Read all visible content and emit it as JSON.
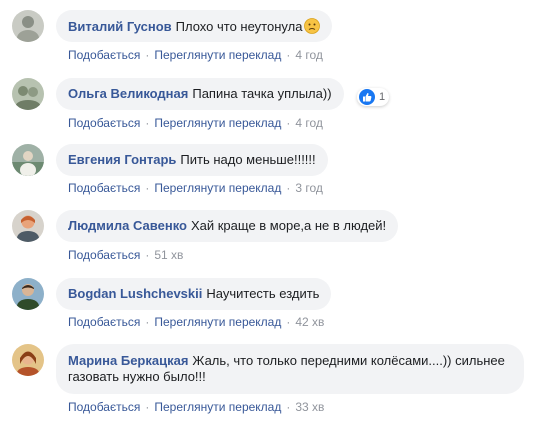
{
  "colors": {
    "author": "#385898",
    "bubble_bg": "#f2f3f5",
    "meta": "#90949c",
    "like_blue": "#1877f2"
  },
  "separator": "·",
  "comments": [
    {
      "author": "Виталий Гуснов",
      "text": "Плохо что неутонула",
      "emoji": "confused-face-icon",
      "actions": {
        "like": "Подобається",
        "translate": "Переглянути переклад",
        "time": "4 год"
      }
    },
    {
      "author": "Ольга Великодная",
      "text": "Папина тачка уплыла))",
      "reactions": {
        "icon": "like-icon",
        "count": "1"
      },
      "actions": {
        "like": "Подобається",
        "translate": "Переглянути переклад",
        "time": "4 год"
      }
    },
    {
      "author": "Евгения Гонтарь",
      "text": "Пить надо меньше!!!!!!",
      "actions": {
        "like": "Подобається",
        "translate": "Переглянути переклад",
        "time": "3 год"
      }
    },
    {
      "author": "Людмила Савенко",
      "text": "Хай краще в море,а не в людей!",
      "actions": {
        "like": "Подобається",
        "time": "51 хв"
      }
    },
    {
      "author": "Bogdan Lushchevskii",
      "text": "Научитесть ездить",
      "actions": {
        "like": "Подобається",
        "translate": "Переглянути переклад",
        "time": "42 хв"
      }
    },
    {
      "author": "Марина Беркацкая",
      "text": "Жаль, что только передними колёсами....)) сильнее газовать нужно было!!!",
      "actions": {
        "like": "Подобається",
        "translate": "Переглянути переклад",
        "time": "33 хв"
      }
    }
  ]
}
